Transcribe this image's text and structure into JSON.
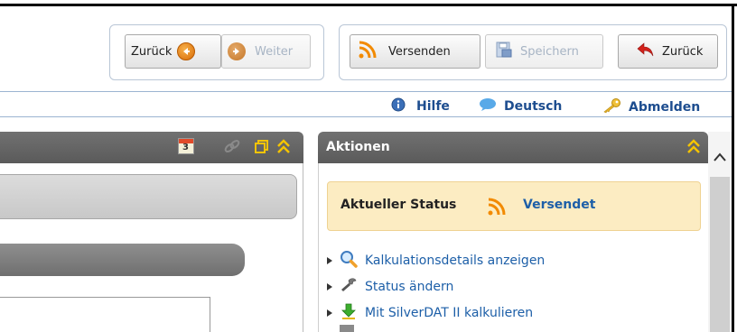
{
  "toolbar": {
    "back_label": "Zurück",
    "forward_label": "Weiter",
    "send_label": "Versenden",
    "save_label": "Speichern",
    "back2_label": "Zurück"
  },
  "topnav": {
    "help": "Hilfe",
    "language": "Deutsch",
    "logout": "Abmelden"
  },
  "calendar_icon_day": "3",
  "actions_panel": {
    "title": "Aktionen",
    "status_label": "Aktueller Status",
    "status_value": "Versendet",
    "items": [
      {
        "label": "Kalkulationsdetails anzeigen",
        "icon": "magnifier-icon"
      },
      {
        "label": "Status ändern",
        "icon": "wrench-icon"
      },
      {
        "label": "Mit SilverDAT II kalkulieren",
        "icon": "download-arrow-icon"
      }
    ]
  },
  "colors": {
    "link_blue": "#1d4d8f",
    "panel_header": "#636363",
    "status_bg": "#fcecc2",
    "accent_yellow": "#f5c400"
  }
}
